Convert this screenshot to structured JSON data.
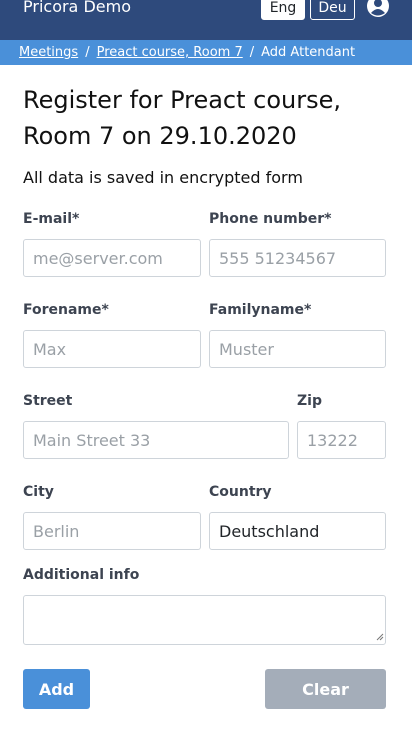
{
  "header": {
    "brand": "Pricora Demo",
    "languages": [
      "Eng",
      "Deu"
    ],
    "active_language": "Eng",
    "user_icon": "user-circle-icon"
  },
  "breadcrumb": {
    "items": [
      "Meetings",
      "Preact course, Room 7",
      "Add Attendant"
    ],
    "separator": "/"
  },
  "form": {
    "title": "Register for Preact course, Room 7 on 29.10.2020",
    "subtitle": "All data is saved in encrypted form",
    "email": {
      "label": "E-mail*",
      "placeholder": "me@server.com",
      "value": ""
    },
    "phone": {
      "label": "Phone number*",
      "placeholder": "555 51234567",
      "value": ""
    },
    "forename": {
      "label": "Forename*",
      "placeholder": "Max",
      "value": ""
    },
    "familyname": {
      "label": "Familyname*",
      "placeholder": "Muster",
      "value": ""
    },
    "street": {
      "label": "Street",
      "placeholder": "Main Street 33",
      "value": ""
    },
    "zip": {
      "label": "Zip",
      "placeholder": "13222",
      "value": ""
    },
    "city": {
      "label": "City",
      "placeholder": "Berlin",
      "value": ""
    },
    "country": {
      "label": "Country",
      "value": "Deutschland"
    },
    "additional_info": {
      "label": "Additional info",
      "value": ""
    },
    "add_label": "Add",
    "clear_label": "Clear"
  },
  "colors": {
    "topbar": "#2e4a7c",
    "breadcrumb": "#4a90d9",
    "primary_button": "#4a90d9",
    "disabled_button": "#a4adb9"
  }
}
